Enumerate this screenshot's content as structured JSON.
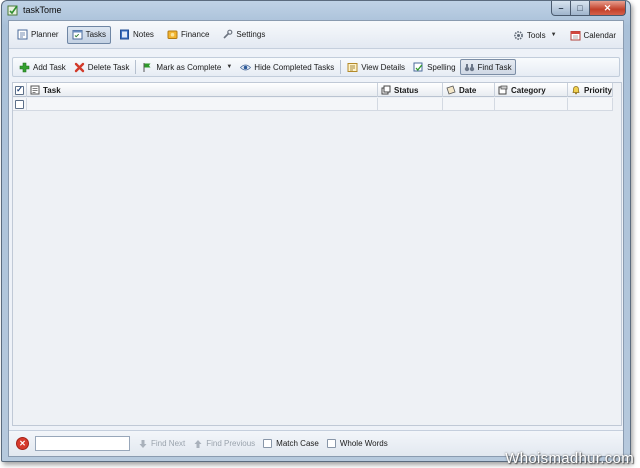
{
  "window": {
    "title": "taskTome",
    "caption_buttons": {
      "minimize": "–",
      "maximize": "□",
      "close": "✕"
    }
  },
  "nav": {
    "items": [
      {
        "label": "Planner",
        "icon": "planner-icon",
        "active": false
      },
      {
        "label": "Tasks",
        "icon": "tasks-icon",
        "active": true
      },
      {
        "label": "Notes",
        "icon": "notes-icon",
        "active": false
      },
      {
        "label": "Finance",
        "icon": "finance-icon",
        "active": false
      },
      {
        "label": "Settings",
        "icon": "settings-icon",
        "active": false
      }
    ],
    "tools_label": "Tools",
    "calendar_label": "Calendar"
  },
  "toolbar": {
    "add_task": "Add Task",
    "delete_task": "Delete Task",
    "mark_complete": "Mark as Complete",
    "hide_completed": "Hide Completed Tasks",
    "view_details": "View Details",
    "spelling": "Spelling",
    "find_task": "Find Task"
  },
  "grid": {
    "columns": {
      "task": "Task",
      "status": "Status",
      "date": "Date",
      "category": "Category",
      "priority": "Priority"
    },
    "header_checked": true,
    "rows": []
  },
  "findbar": {
    "input_value": "",
    "find_next": "Find Next",
    "find_previous": "Find Previous",
    "match_case": "Match Case",
    "whole_words": "Whole Words"
  },
  "watermark": "Whoismadhur.com",
  "colors": {
    "accent": "#6f86a4",
    "add_green": "#2e9a2a",
    "delete_red": "#d23a2a",
    "close_red": "#c2402a"
  }
}
